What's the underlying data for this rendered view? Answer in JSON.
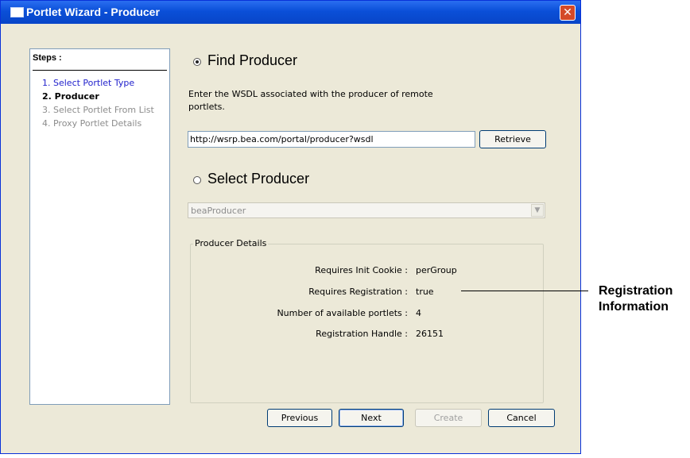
{
  "window": {
    "title": "Portlet Wizard - Producer",
    "close_glyph": "✕"
  },
  "steps": {
    "header": "Steps :",
    "items": [
      {
        "label": "1. Select Portlet Type",
        "state": "done"
      },
      {
        "label": "2. Producer",
        "state": "current"
      },
      {
        "label": "3. Select Portlet From List",
        "state": "pending"
      },
      {
        "label": "4. Proxy Portlet Details",
        "state": "pending"
      }
    ]
  },
  "find_producer": {
    "label": "Find Producer",
    "selected": true,
    "description": "Enter the WSDL associated with the producer of remote portlets.",
    "url_value": "http://wsrp.bea.com/portal/producer?wsdl",
    "retrieve_label": "Retrieve"
  },
  "select_producer": {
    "label": "Select Producer",
    "selected": false,
    "dropdown_value": "beaProducer"
  },
  "producer_details": {
    "legend": "Producer Details",
    "rows": [
      {
        "key": "Requires Init Cookie  :",
        "value": "perGroup"
      },
      {
        "key": "Requires Registration  :",
        "value": "true"
      },
      {
        "key": "Number of available portlets  :",
        "value": "4"
      },
      {
        "key": "Registration Handle  :",
        "value": "26151"
      }
    ]
  },
  "buttons": {
    "previous": "Previous",
    "next": "Next",
    "create": "Create",
    "cancel": "Cancel"
  },
  "annotation": {
    "line1": "Registration",
    "line2": "Information"
  }
}
